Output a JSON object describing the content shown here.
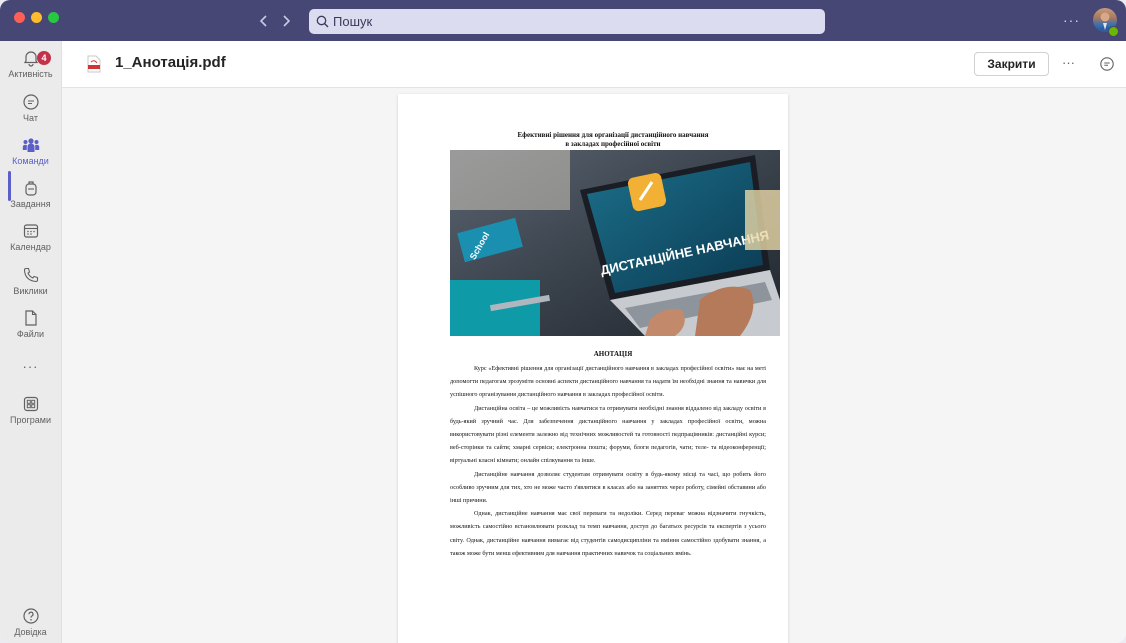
{
  "titlebar": {
    "search_placeholder": "Пошук",
    "more_label": "···"
  },
  "rail": {
    "items": [
      {
        "label": "Активність",
        "badge": "4"
      },
      {
        "label": "Чат"
      },
      {
        "label": "Команди"
      },
      {
        "label": "Завдання"
      },
      {
        "label": "Календар"
      },
      {
        "label": "Виклики"
      },
      {
        "label": "Файли"
      },
      {
        "label": "···"
      },
      {
        "label": "Програми"
      },
      {
        "label": "Довідка"
      }
    ]
  },
  "header": {
    "file_name": "1_Анотація.pdf",
    "close_label": "Закрити",
    "more_label": "···"
  },
  "document": {
    "title_line1": "Ефективні рішення для організації дистанційного навчання",
    "title_line2": "в закладах професійної освіти",
    "image_text": "ДИСТАНЦІЙНЕ НАВЧАННЯ",
    "book_text": "School",
    "annotation_heading": "АНОТАЦІЯ",
    "paragraphs": [
      "Курс «Ефективні рішення для організації дистанційного навчання в закладах професійної освіти» має на меті допомогти педагогам зрозуміти основні аспекти дистанційного навчання та надати їм необхідні знання та навички для успішного організування дистанційного навчання в закладах професійної освіти.",
      "Дистанційна освіта – це можливість навчатися та отримувати необхідні знання віддалено від закладу освіти в будь-який зручний час. Для забезпечення дистанційного навчання у закладах професійної освіти, можна використовувати різні елементи залежно від технічних можливостей та готовності педпрацівників: дистанційні курси; веб-сторінки та сайти; хмарні сервіси; електронна пошта; форуми, блоги педагогів, чати; теле- та відеоконференції; віртуальні класні кімнати; онлайн спілкування та інше.",
      "Дистанційне навчання дозволяє студентам отримувати освіту в будь-якому місці та часі, що робить його особливо зручним для тих, хто не може часто з'являтися в класах або на заняттях через роботу, сімейні обставини або інші причини.",
      "Однак, дистанційне навчання має свої переваги та недоліки. Серед переваг можна відзначити гнучкість, можливість самостійно встановлювати розклад та темп навчання, доступ до багатьох ресурсів та експертів з усього світу. Однак, дистанційне навчання вимагає від студентів самодисципліни та вміння самостійно здобувати знання, а також може бути менш ефективним для навчання практичних навичок та соціальних вмінь."
    ]
  },
  "colors": {
    "titlebar": "#464775",
    "accent": "#5b5fc7",
    "badge": "#c4314b"
  }
}
